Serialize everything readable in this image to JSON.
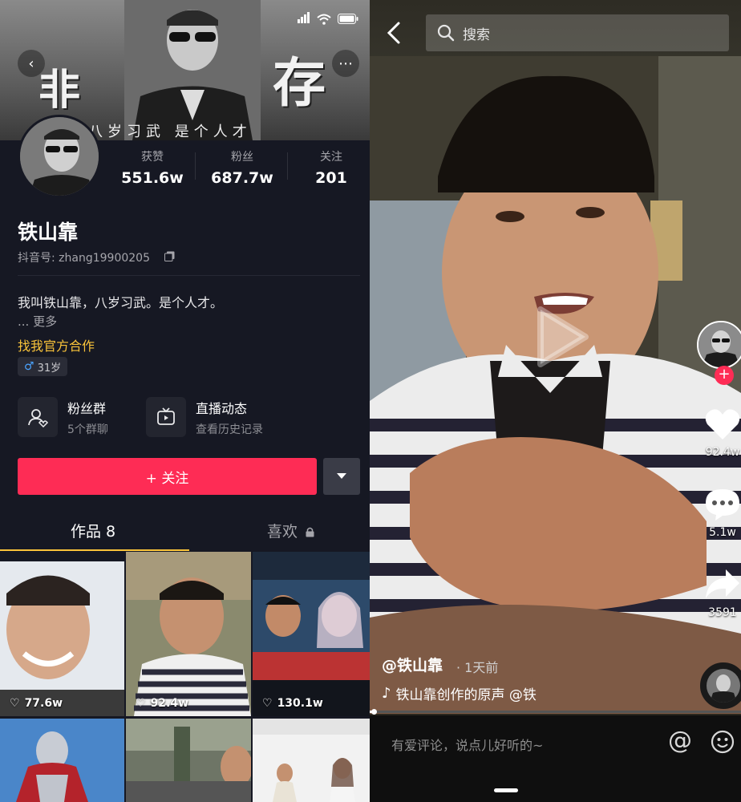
{
  "profile": {
    "cover_text_left": "非",
    "cover_text_right": "存",
    "cover_subtitle": "八岁习武 是个人才",
    "stats": [
      {
        "label": "获赞",
        "value": "551.6w"
      },
      {
        "label": "粉丝",
        "value": "687.7w"
      },
      {
        "label": "关注",
        "value": "201"
      }
    ],
    "name": "铁山靠",
    "douyin_id": "抖音号: zhang19900205",
    "bio": "我叫铁山靠，八岁习武。是个人才。",
    "more": "... 更多",
    "cooperation": "找我官方合作",
    "age_tag": "31岁",
    "features": [
      {
        "title": "粉丝群",
        "subtitle": "5个群聊",
        "icon": "fans-group-icon"
      },
      {
        "title": "直播动态",
        "subtitle": "查看历史记录",
        "icon": "live-tv-icon"
      }
    ],
    "follow_label": "+ 关注",
    "tabs": {
      "works": "作品 8",
      "likes": "喜欢"
    },
    "thumbnails": [
      {
        "likes": "77.6w"
      },
      {
        "likes": "92.4w"
      },
      {
        "likes": "130.1w"
      },
      {
        "likes": ""
      },
      {
        "likes": ""
      },
      {
        "likes": ""
      }
    ],
    "colors": {
      "background": "#161823",
      "accent": "#fe2c55",
      "highlight": "#f9c33a"
    }
  },
  "video": {
    "search_placeholder": "搜索",
    "author": "@铁山靠",
    "posted": "· 1天前",
    "music": "铁山靠创作的原声    @铁",
    "actions": [
      {
        "icon": "heart-icon",
        "count": "92.4w"
      },
      {
        "icon": "comment-icon",
        "count": "5.1w"
      },
      {
        "icon": "share-icon",
        "count": "3591"
      }
    ],
    "progress": 0.01,
    "comment_placeholder": "有爱评论，说点儿好听的~",
    "at_symbol": "@"
  }
}
